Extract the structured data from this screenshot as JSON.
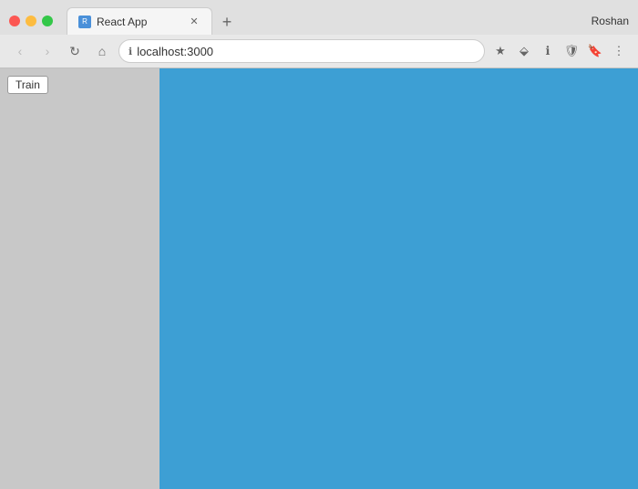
{
  "browser": {
    "tab": {
      "favicon_label": "R",
      "title": "React App",
      "close_symbol": "✕"
    },
    "new_tab_symbol": "+",
    "user": "Roshan",
    "address": "localhost:3000",
    "address_icon": "ℹ",
    "nav": {
      "back": "‹",
      "forward": "›",
      "refresh": "↻",
      "home": "⌂"
    },
    "toolbar_icons": [
      "★",
      "⬙",
      "ℹ",
      "🛡",
      "🔖",
      "⋮"
    ]
  },
  "page": {
    "sidebar": {
      "train_button_label": "Train"
    },
    "main_color": "#3d9fd4"
  }
}
